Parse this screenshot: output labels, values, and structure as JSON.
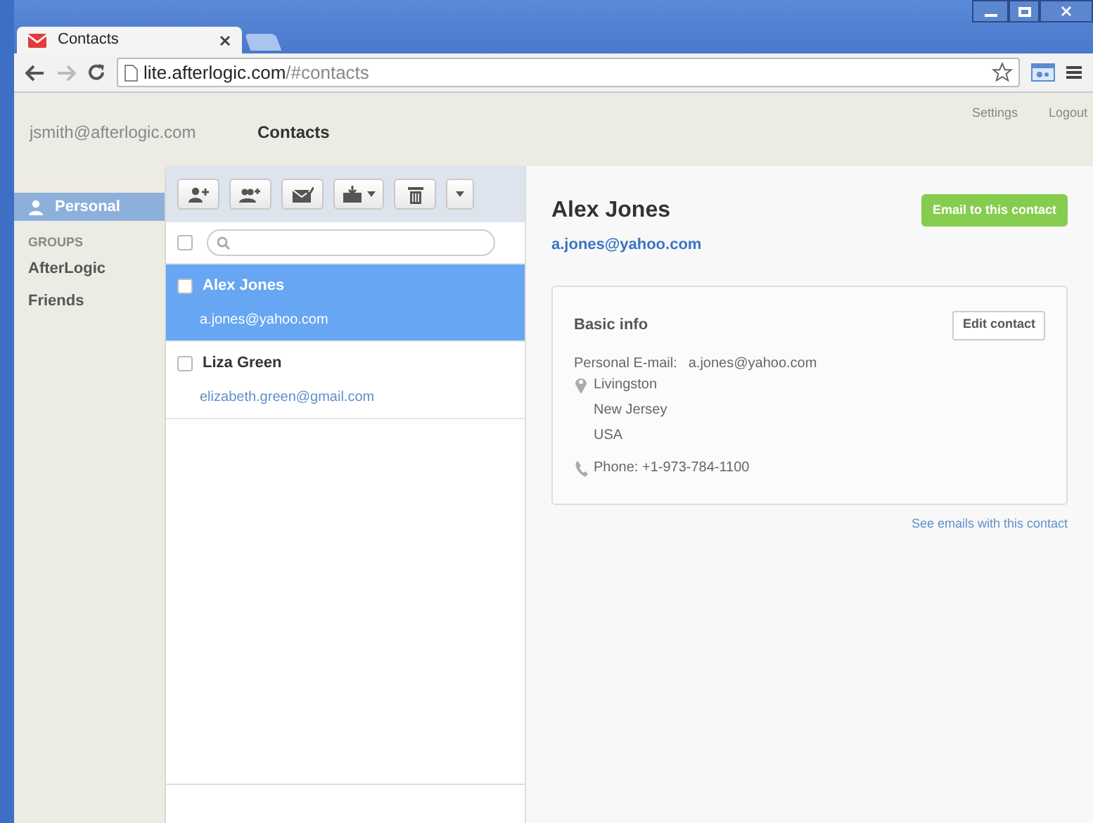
{
  "browser": {
    "tab_title": "Contacts",
    "url_host": "lite.afterlogic.com",
    "url_path": "/#contacts"
  },
  "header": {
    "account": "jsmith@afterlogic.com",
    "title": "Contacts",
    "links": [
      "Settings",
      "Logout"
    ]
  },
  "sidebar": {
    "personal": {
      "label": "Personal",
      "selected": true
    },
    "groups_heading": "GROUPS",
    "groups": [
      {
        "label": "AfterLogic",
        "selected": false
      },
      {
        "label": "Friends",
        "selected": false
      }
    ]
  },
  "select_all": {
    "checked": false
  },
  "contacts": [
    {
      "name": "Alex Jones",
      "email": "a.jones@yahoo.com",
      "selected": true,
      "checked": false
    },
    {
      "name": "Liza Green",
      "email": "elizabeth.green@gmail.com",
      "selected": false,
      "checked": false
    }
  ],
  "detail": {
    "name": "Alex Jones",
    "email": "a.jones@yahoo.com",
    "email_button": "Email to this contact",
    "card": {
      "title": "Basic info",
      "edit_button": "Edit contact",
      "email_label": "Personal E-mail:",
      "email_value": "a.jones@yahoo.com",
      "address": [
        "Livingston",
        "New Jersey",
        "USA"
      ],
      "phone": "Phone: +1-973-784-1100"
    },
    "see_link": "See emails with this contact"
  }
}
